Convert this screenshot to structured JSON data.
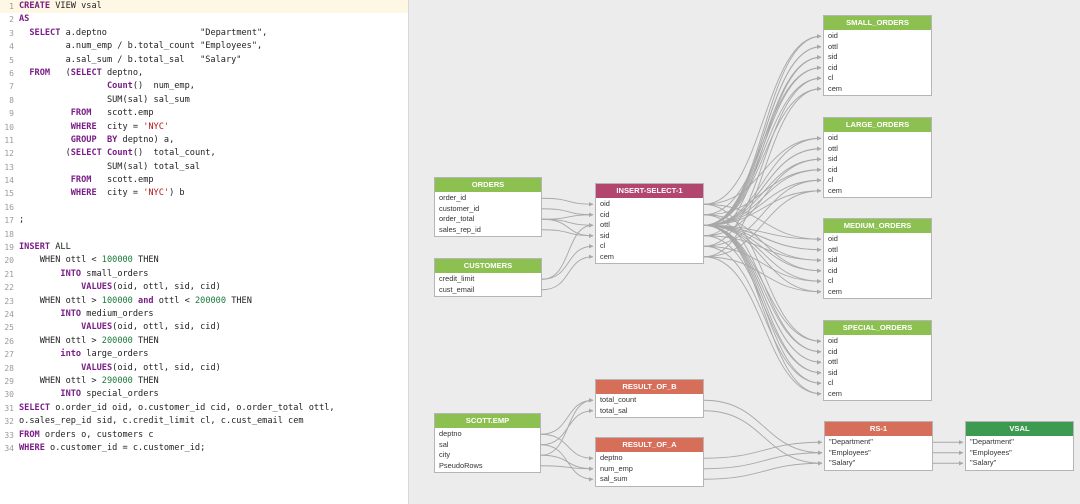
{
  "editor": {
    "lines": [
      [
        [
          "kw",
          "CREATE"
        ],
        [
          "t",
          " VIEW vsal"
        ]
      ],
      [
        [
          "kw",
          "AS"
        ]
      ],
      [
        [
          "t",
          "  "
        ],
        [
          "kw",
          "SELECT"
        ],
        [
          "t",
          " a.deptno                  \"Department\","
        ]
      ],
      [
        [
          "t",
          "         a.num_emp / b.total_count \"Employees\","
        ]
      ],
      [
        [
          "t",
          "         a.sal_sum / b.total_sal   \"Salary\""
        ]
      ],
      [
        [
          "t",
          "  "
        ],
        [
          "kw",
          "FROM"
        ],
        [
          "t",
          "   ("
        ],
        [
          "kw",
          "SELECT"
        ],
        [
          "t",
          " deptno,"
        ]
      ],
      [
        [
          "t",
          "                 "
        ],
        [
          "kw",
          "Count"
        ],
        [
          "t",
          "()  num_emp,"
        ]
      ],
      [
        [
          "t",
          "                 SUM(sal) sal_sum"
        ]
      ],
      [
        [
          "t",
          "          "
        ],
        [
          "kw",
          "FROM"
        ],
        [
          "t",
          "   scott.emp"
        ]
      ],
      [
        [
          "t",
          "          "
        ],
        [
          "kw",
          "WHERE"
        ],
        [
          "t",
          "  city = "
        ],
        [
          "str",
          "'NYC'"
        ]
      ],
      [
        [
          "t",
          "          "
        ],
        [
          "kw",
          "GROUP"
        ],
        [
          "t",
          "  "
        ],
        [
          "kw",
          "BY"
        ],
        [
          "t",
          " deptno) a,"
        ]
      ],
      [
        [
          "t",
          "         ("
        ],
        [
          "kw",
          "SELECT"
        ],
        [
          "t",
          " "
        ],
        [
          "kw",
          "Count"
        ],
        [
          "t",
          "()  total_count,"
        ]
      ],
      [
        [
          "t",
          "                 SUM(sal) total_sal"
        ]
      ],
      [
        [
          "t",
          "          "
        ],
        [
          "kw",
          "FROM"
        ],
        [
          "t",
          "   scott.emp"
        ]
      ],
      [
        [
          "t",
          "          "
        ],
        [
          "kw",
          "WHERE"
        ],
        [
          "t",
          "  city = "
        ],
        [
          "str",
          "'NYC'"
        ],
        [
          "t",
          ") b"
        ]
      ],
      [
        [
          "t",
          ""
        ]
      ],
      [
        [
          "t",
          ";"
        ]
      ],
      [
        [
          "t",
          ""
        ]
      ],
      [
        [
          "kw",
          "INSERT"
        ],
        [
          "t",
          " ALL"
        ]
      ],
      [
        [
          "t",
          "    WHEN ottl < "
        ],
        [
          "num",
          "100000"
        ],
        [
          "t",
          " THEN"
        ]
      ],
      [
        [
          "t",
          "        "
        ],
        [
          "kw",
          "INTO"
        ],
        [
          "t",
          " small_orders"
        ]
      ],
      [
        [
          "t",
          "            "
        ],
        [
          "kw",
          "VALUES"
        ],
        [
          "t",
          "(oid, ottl, sid, cid)"
        ]
      ],
      [
        [
          "t",
          "    WHEN ottl > "
        ],
        [
          "num",
          "100000"
        ],
        [
          "t",
          " "
        ],
        [
          "kw",
          "and"
        ],
        [
          "t",
          " ottl < "
        ],
        [
          "num",
          "200000"
        ],
        [
          "t",
          " THEN"
        ]
      ],
      [
        [
          "t",
          "        "
        ],
        [
          "kw",
          "INTO"
        ],
        [
          "t",
          " medium_orders"
        ]
      ],
      [
        [
          "t",
          "            "
        ],
        [
          "kw",
          "VALUES"
        ],
        [
          "t",
          "(oid, ottl, sid, cid)"
        ]
      ],
      [
        [
          "t",
          "    WHEN ottl > "
        ],
        [
          "num",
          "200000"
        ],
        [
          "t",
          " THEN"
        ]
      ],
      [
        [
          "t",
          "        "
        ],
        [
          "kw",
          "into"
        ],
        [
          "t",
          " large_orders"
        ]
      ],
      [
        [
          "t",
          "            "
        ],
        [
          "kw",
          "VALUES"
        ],
        [
          "t",
          "(oid, ottl, sid, cid)"
        ]
      ],
      [
        [
          "t",
          "    WHEN ottl > "
        ],
        [
          "num",
          "290000"
        ],
        [
          "t",
          " THEN"
        ]
      ],
      [
        [
          "t",
          "        "
        ],
        [
          "kw",
          "INTO"
        ],
        [
          "t",
          " special_orders"
        ]
      ],
      [
        [
          "kw",
          "SELECT"
        ],
        [
          "t",
          " o.order_id oid, o.customer_id cid, o.order_total ottl,"
        ]
      ],
      [
        [
          "t",
          "o.sales_rep_id sid, c.credit_limit cl, c.cust_email cem"
        ]
      ],
      [
        [
          "kw",
          "FROM"
        ],
        [
          "t",
          " orders o, customers c"
        ]
      ],
      [
        [
          "kw",
          "WHERE"
        ],
        [
          "t",
          " o.customer_id = c.customer_id;"
        ]
      ]
    ]
  },
  "nodes": [
    {
      "id": "orders",
      "title": "ORDERS",
      "style": "g",
      "rows": [
        "order_id",
        "customer_id",
        "order_total",
        "sales_rep_id"
      ]
    },
    {
      "id": "customers",
      "title": "CUSTOMERS",
      "style": "g",
      "rows": [
        "credit_limit",
        "cust_email"
      ]
    },
    {
      "id": "insert",
      "title": "INSERT-SELECT-1",
      "style": "m",
      "rows": [
        "oid",
        "cid",
        "ottl",
        "sid",
        "cl",
        "cem"
      ]
    },
    {
      "id": "small",
      "title": "SMALL_ORDERS",
      "style": "g",
      "rows": [
        "oid",
        "ottl",
        "sid",
        "cid",
        "cl",
        "cem"
      ]
    },
    {
      "id": "large",
      "title": "LARGE_ORDERS",
      "style": "g",
      "rows": [
        "oid",
        "ottl",
        "sid",
        "cid",
        "cl",
        "cem"
      ]
    },
    {
      "id": "medium",
      "title": "MEDIUM_ORDERS",
      "style": "g",
      "rows": [
        "oid",
        "ottl",
        "sid",
        "cid",
        "cl",
        "cem"
      ]
    },
    {
      "id": "special",
      "title": "SPECIAL_ORDERS",
      "style": "g",
      "rows": [
        "oid",
        "cid",
        "ottl",
        "sid",
        "cl",
        "cem"
      ]
    },
    {
      "id": "scottemp",
      "title": "SCOTT.EMP",
      "style": "g",
      "rows": [
        "deptno",
        "sal",
        "city",
        "PseudoRows"
      ]
    },
    {
      "id": "resb",
      "title": "RESULT_OF_B",
      "style": "r",
      "rows": [
        "total_count",
        "total_sal"
      ]
    },
    {
      "id": "resa",
      "title": "RESULT_OF_A",
      "style": "r",
      "rows": [
        "deptno",
        "num_emp",
        "sal_sum"
      ]
    },
    {
      "id": "rs1",
      "title": "RS-1",
      "style": "r",
      "rows": [
        "\"Department\"",
        "\"Employees\"",
        "\"Salary\""
      ]
    },
    {
      "id": "vsal",
      "title": "VSAL",
      "style": "dg",
      "rows": [
        "\"Department\"",
        "\"Employees\"",
        "\"Salary\""
      ]
    }
  ],
  "colors": {
    "source": "#8cc050",
    "process": "#b3466e",
    "result": "#d76e5a",
    "view": "#3c9b50",
    "edge": "#a8a8a8"
  }
}
